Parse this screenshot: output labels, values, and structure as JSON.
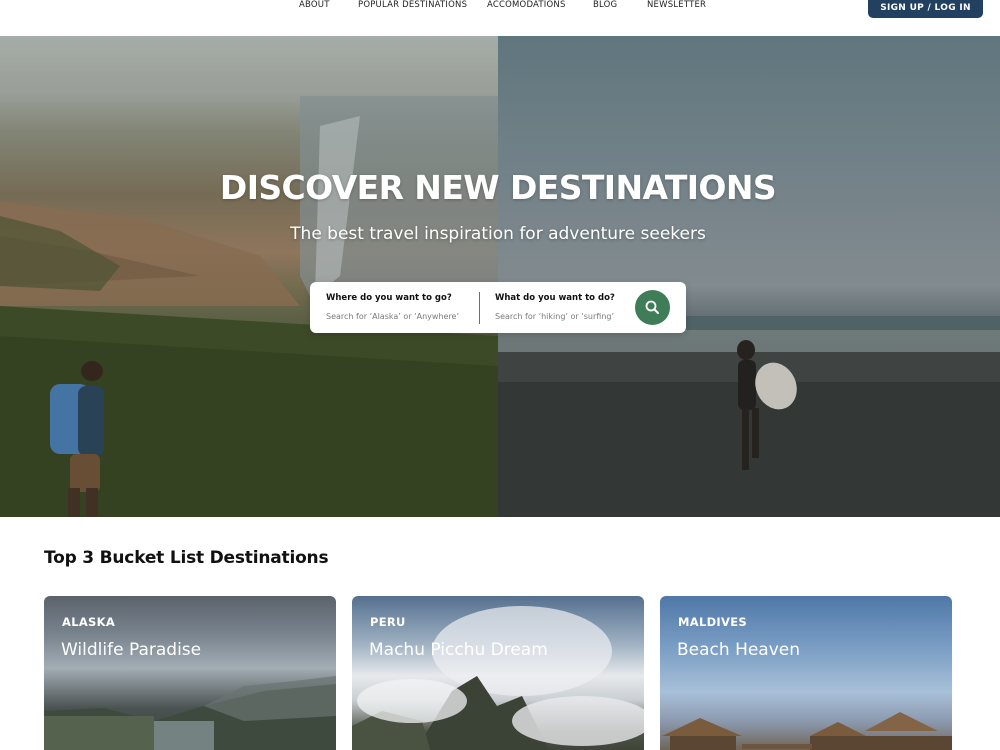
{
  "nav": {
    "links": [
      "ABOUT",
      "POPULAR DESTINATIONS",
      "ACCOMODATIONS",
      "BLOG",
      "NEWSLETTER"
    ],
    "signup_label": "SIGN UP / LOG IN",
    "accent_color": "#22405f"
  },
  "hero": {
    "title": "DISCOVER NEW DESTINATIONS",
    "subtitle": "The best travel inspiration for adventure seekers",
    "search": {
      "where_label": "Where do you want to go?",
      "where_placeholder": "Search for ‘Alaska’ or ‘Anywhere’",
      "what_label": "What do you want to do?",
      "what_placeholder": "Search for ‘hiking’ or ‘surfing’",
      "button_icon": "search-icon",
      "button_color": "#3f7d59"
    }
  },
  "section": {
    "title": "Top 3 Bucket List Destinations",
    "cards": [
      {
        "country": "ALASKA",
        "title": "Wildlife Paradise"
      },
      {
        "country": "PERU",
        "title": "Machu Picchu Dream"
      },
      {
        "country": "MALDIVES",
        "title": "Beach Heaven"
      }
    ]
  }
}
